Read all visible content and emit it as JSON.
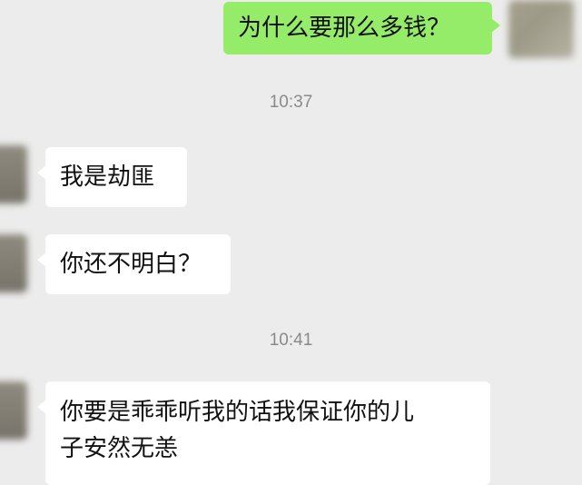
{
  "messages": [
    {
      "side": "me",
      "text": "为什么要那么多钱？"
    },
    {
      "timestamp": "10:37"
    },
    {
      "side": "other",
      "text": "我是劫匪"
    },
    {
      "side": "other",
      "text": "你还不明白？"
    },
    {
      "timestamp": "10:41"
    },
    {
      "side": "other",
      "text": "你要是乖乖听我的话我保证你的儿子安然无恙"
    }
  ],
  "chat": {
    "msg1": "为什么要那么多钱？",
    "time1": "10:37",
    "msg2": "我是劫匪",
    "msg3": "你还不明白？",
    "time2": "10:41",
    "msg4_line1": "你要是乖乖听我的话我保证你的儿",
    "msg4_line2": "子安然无恙"
  },
  "colors": {
    "background": "#ececec",
    "self_bubble": "#95ec69",
    "other_bubble": "#ffffff",
    "timestamp": "#8a8a8a"
  }
}
